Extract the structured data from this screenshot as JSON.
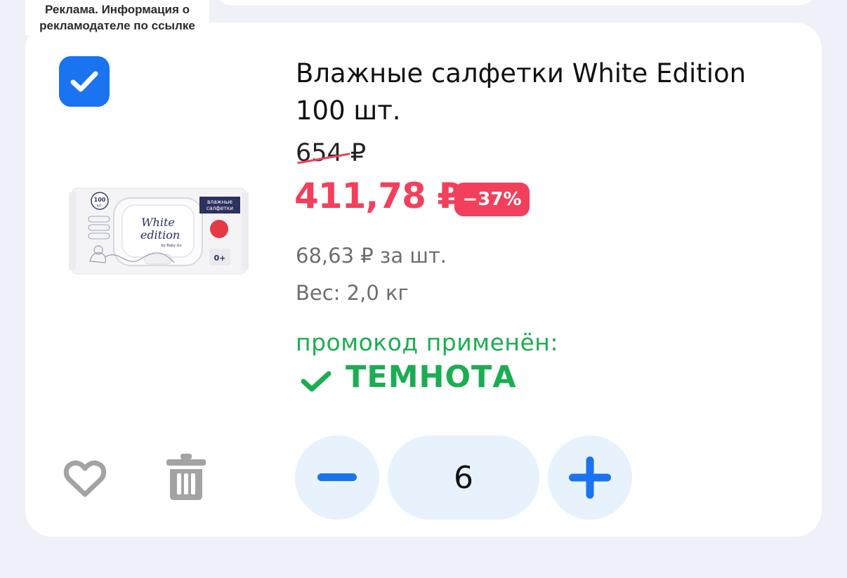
{
  "ad_label": "Реклама. Информация о рекламодателе по ссылке",
  "product": {
    "title": "Влажные салфетки White Edition 100 шт.",
    "old_price": "654 ₽",
    "new_price": "411,78 ₽",
    "discount": "−37%",
    "unit_price": "68,63 ₽ за шт.",
    "weight": "Вес: 2,0 кг",
    "image": {
      "count_badge": "100",
      "count_unit": "шт.",
      "brand_line1": "White",
      "brand_line2": "edition",
      "brand_sub": "by Baby Go",
      "category_line1": "влажные",
      "category_line2": "салфетки",
      "age": "0+"
    }
  },
  "promo": {
    "label": "промокод применён:",
    "code": "ТЕМНОТА"
  },
  "quantity": {
    "value": "6"
  },
  "icons": {
    "checkbox": "check-icon",
    "favorite": "heart-icon",
    "delete": "trash-icon",
    "decrease": "minus-icon",
    "increase": "plus-icon",
    "promo_check": "check-icon"
  },
  "colors": {
    "accent": "#1a73f0",
    "price_red": "#f2405c",
    "promo_green": "#1cad52",
    "stepper_bg": "#e8f2fd"
  },
  "selected": true
}
